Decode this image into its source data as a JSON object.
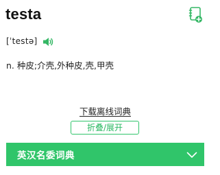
{
  "entry": {
    "headword": "testa",
    "phonetic": "[ˈtestə]",
    "definition": "n. 种皮;介壳,外种皮,壳,甲壳"
  },
  "actions": {
    "download_label": "下载离线词典",
    "toggle_label": "折叠/展开"
  },
  "dictionary_bar": {
    "title": "英汉名委词典"
  },
  "icons": {
    "wordbook": "add-to-wordbook-icon",
    "speaker": "speaker-icon",
    "chevron": "chevron-down-icon"
  },
  "colors": {
    "accent": "#30c56a",
    "text": "#222222"
  }
}
